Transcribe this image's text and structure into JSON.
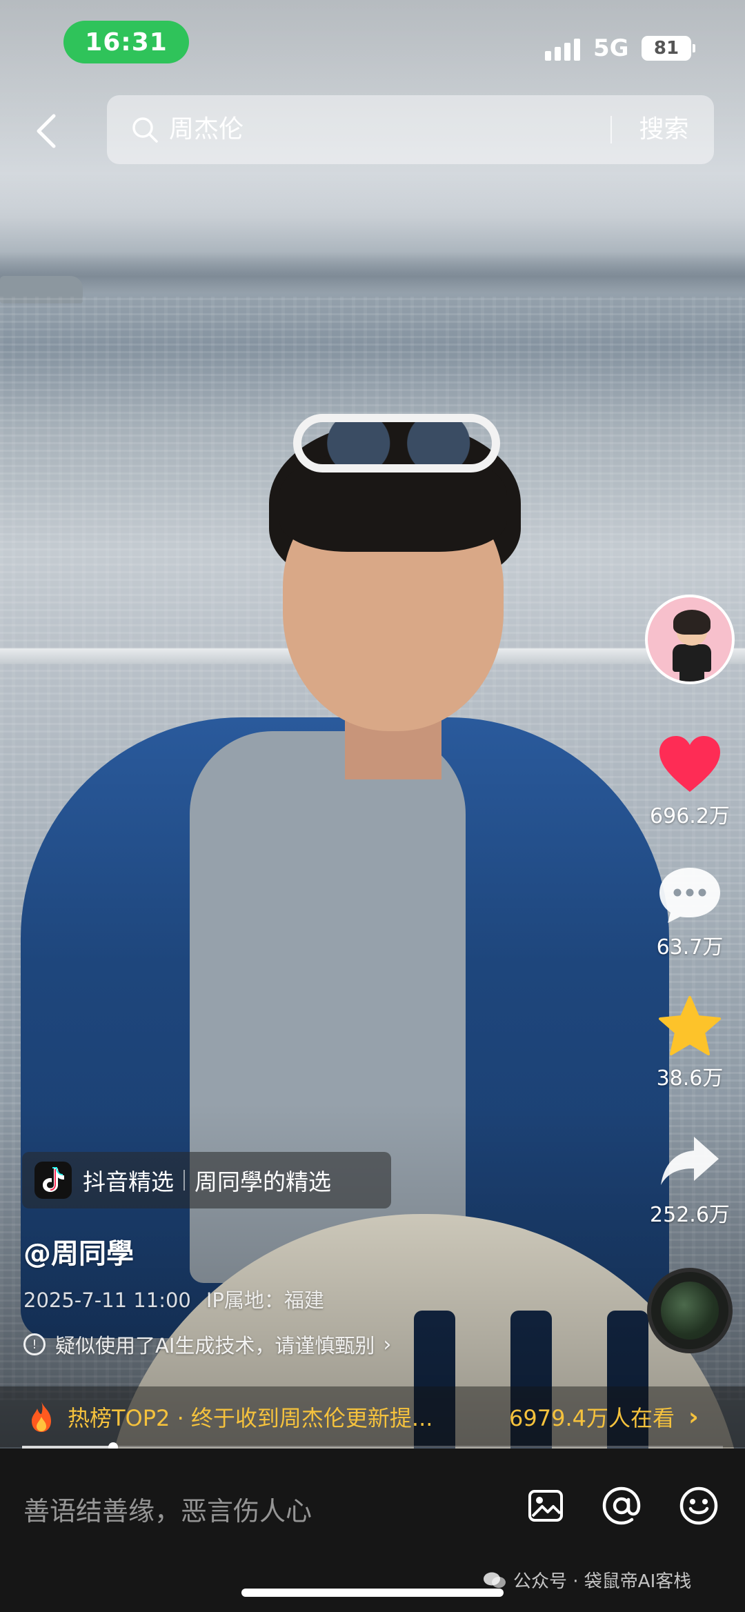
{
  "status_bar": {
    "time": "16:31",
    "network": "5G",
    "battery": "81"
  },
  "search": {
    "query": "周杰伦",
    "button_label": "搜索"
  },
  "actions": {
    "like_count": "696.2万",
    "comment_count": "63.7万",
    "favorite_count": "38.6万",
    "share_count": "252.6万"
  },
  "video": {
    "tag_source": "抖音精选",
    "tag_collection": "周同學的精选",
    "author": "@周同學",
    "date": "2025-7-11 11:00",
    "ip_location": "IP属地：福建",
    "ai_notice": "疑似使用了AI生成技术，请谨慎甄别",
    "progress_fraction": 0.13
  },
  "hot": {
    "text": "热榜TOP2 · 终于收到周杰伦更新提...",
    "viewers": "6979.4万人在看"
  },
  "comment_bar": {
    "placeholder": "善语结善缘，恶言伤人心"
  },
  "watermark": "公众号 · 袋鼠帝AI客栈",
  "colors": {
    "time_pill": "#2fc35a",
    "like": "#fe2c55",
    "favorite": "#fdc32a",
    "hot_text": "#f5c23d"
  },
  "icons": {
    "back": "chevron-left-icon",
    "search": "search-icon",
    "like": "heart-icon",
    "comment": "speech-bubble-icon",
    "favorite": "star-icon",
    "share": "share-arrow-icon",
    "image": "image-icon",
    "mention": "at-icon",
    "emoji": "smile-icon"
  }
}
